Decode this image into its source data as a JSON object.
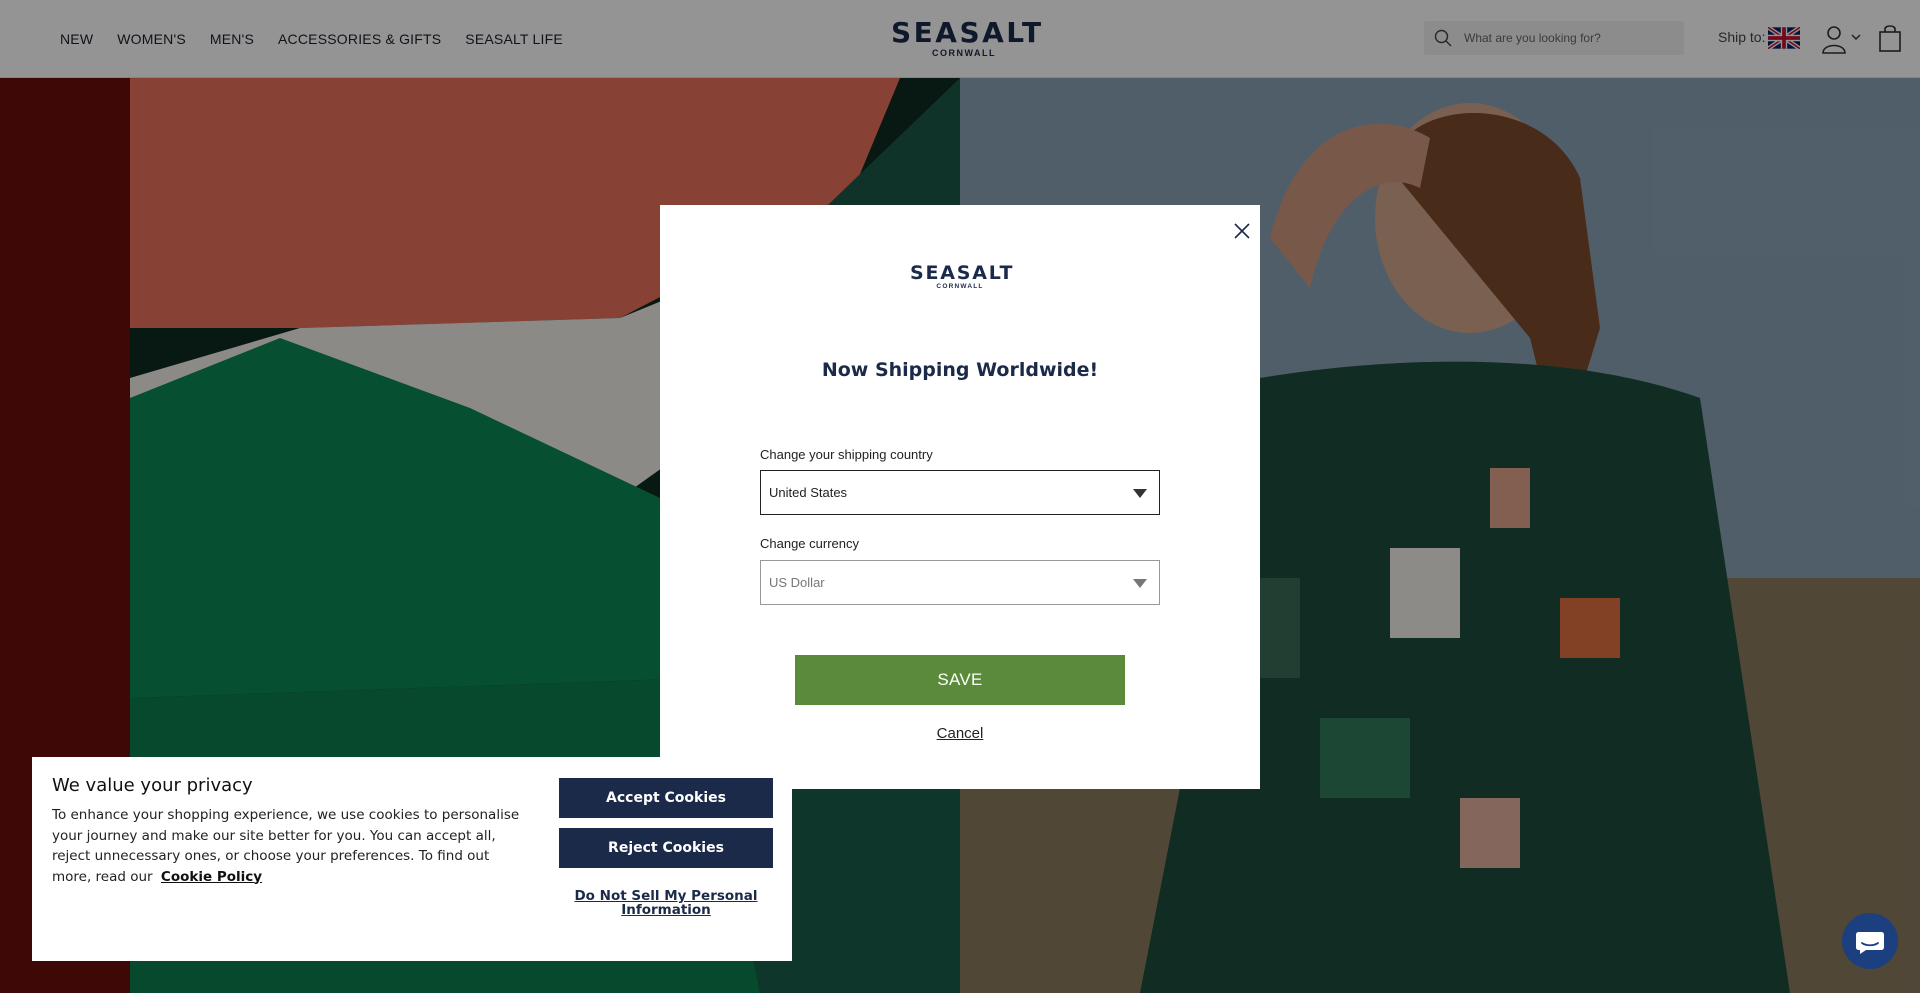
{
  "header": {
    "nav": [
      "NEW",
      "WOMEN'S",
      "MEN'S",
      "ACCESSORIES & GIFTS",
      "SEASALT LIFE"
    ],
    "logo_main": "SEASALT",
    "logo_sub": "CORNWALL",
    "search_placeholder": "What are you looking for?",
    "ship_to": "Ship to:",
    "flag_icon": "uk-flag-icon",
    "account_icon": "user-icon",
    "bag_icon": "shopping-bag-icon"
  },
  "modal": {
    "logo_main": "SEASALT",
    "logo_sub": "CORNWALL",
    "title": "Now Shipping Worldwide!",
    "country_label": "Change your shipping country",
    "country_value": "United States",
    "currency_label": "Change currency",
    "currency_value": "US Dollar",
    "save_label": "SAVE",
    "cancel_label": "Cancel"
  },
  "cookie": {
    "title": "We value your privacy",
    "body": "To enhance your shopping experience, we use cookies to personalise your journey and make our site better for you. You can accept all, reject unnecessary ones, or choose your preferences. To find out more, read our",
    "policy_link": "Cookie Policy",
    "accept_label": "Accept Cookies",
    "reject_label": "Reject Cookies",
    "dns_label": "Do Not Sell My Personal Information"
  },
  "colors": {
    "brand_navy": "#1c2a4a",
    "save_green": "#5a8a3a",
    "chat_blue": "#1c3f80"
  }
}
